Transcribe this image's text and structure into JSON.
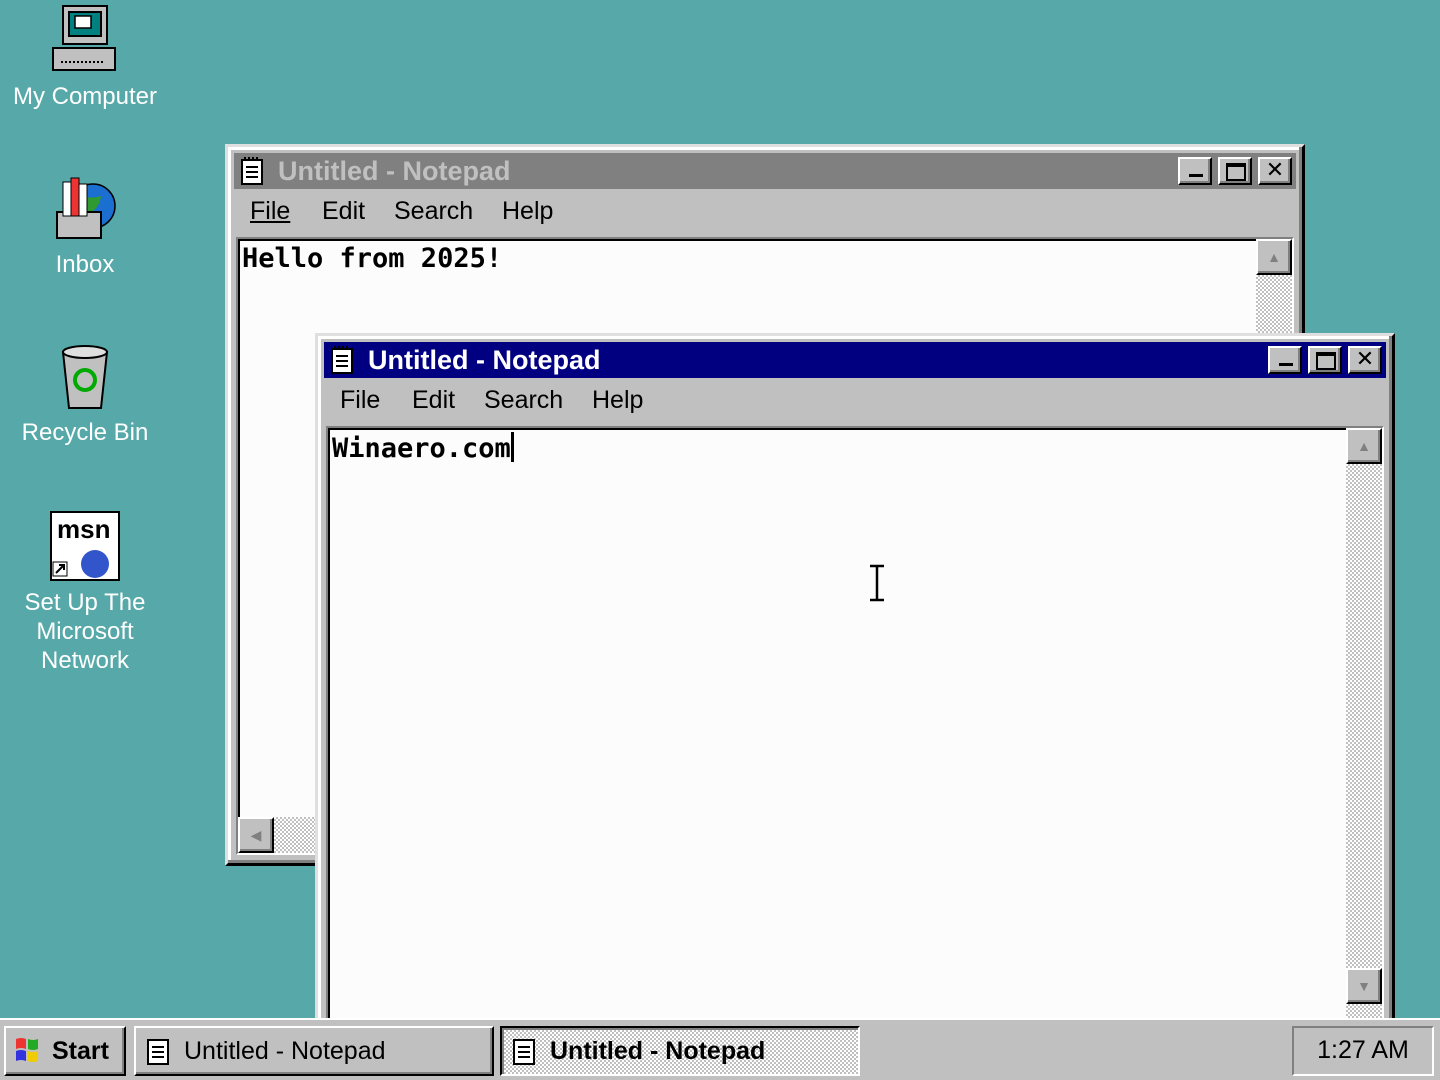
{
  "desktop": {
    "icons": [
      {
        "label": "My Computer",
        "icon": "my-computer-icon"
      },
      {
        "label": "Inbox",
        "icon": "inbox-icon"
      },
      {
        "label": "Recycle Bin",
        "icon": "recycle-bin-icon"
      },
      {
        "label": "Set Up The\nMicrosoft\nNetwork",
        "icon": "msn-icon"
      }
    ],
    "background_color": "#57a8a8"
  },
  "windows": [
    {
      "title": "Untitled - Notepad",
      "active": false,
      "menu": {
        "file": "File",
        "edit": "Edit",
        "search": "Search",
        "help": "Help"
      },
      "text": "Hello from 2025!"
    },
    {
      "title": "Untitled - Notepad",
      "active": true,
      "menu": {
        "file": "File",
        "edit": "Edit",
        "search": "Search",
        "help": "Help"
      },
      "text": "Winaero.com"
    }
  ],
  "title_buttons": {
    "close": "✕"
  },
  "taskbar": {
    "start_label": "Start",
    "buttons": [
      {
        "label": "Untitled - Notepad",
        "pressed": false
      },
      {
        "label": "Untitled - Notepad",
        "pressed": true
      }
    ],
    "clock": "1:27 AM"
  },
  "colors": {
    "active_title": "#000080",
    "inactive_title": "#808080",
    "face": "#c0c0c0"
  }
}
